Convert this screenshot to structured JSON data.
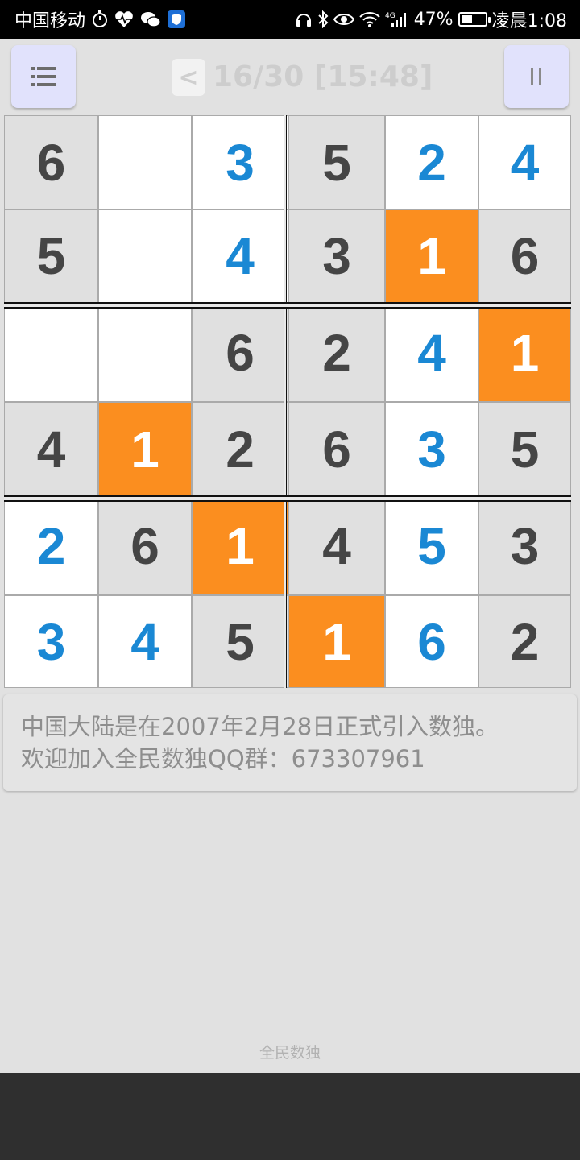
{
  "status_bar": {
    "carrier": "中国移动",
    "battery": "47%",
    "battery_level": 0.47,
    "time": "凌晨1:08",
    "left_icons": [
      "stopwatch-icon",
      "heart-rate-icon",
      "wechat-icon",
      "shield-app-icon"
    ],
    "right_icons": [
      "headset-icon",
      "bluetooth-icon",
      "eye-icon",
      "wifi-icon",
      "signal-4g-icon"
    ]
  },
  "header": {
    "menu_icon": "menu-list-icon",
    "back_label": "<",
    "progress_label": "16/30 [15:48]",
    "pause_label": "II"
  },
  "board": {
    "size": 6,
    "box_rows": 2,
    "box_cols": 3,
    "colors": {
      "given": "#e0e0e0",
      "user": "#1a88d4",
      "highlight": "#fb8e1f",
      "given_text": "#454545"
    },
    "cells": [
      [
        {
          "v": "6",
          "t": "given"
        },
        {
          "v": "",
          "t": "empty"
        },
        {
          "v": "3",
          "t": "user"
        },
        {
          "v": "5",
          "t": "given"
        },
        {
          "v": "2",
          "t": "user"
        },
        {
          "v": "4",
          "t": "user"
        }
      ],
      [
        {
          "v": "5",
          "t": "given"
        },
        {
          "v": "",
          "t": "empty"
        },
        {
          "v": "4",
          "t": "user"
        },
        {
          "v": "3",
          "t": "given"
        },
        {
          "v": "1",
          "t": "hl"
        },
        {
          "v": "6",
          "t": "given"
        }
      ],
      [
        {
          "v": "",
          "t": "empty"
        },
        {
          "v": "",
          "t": "empty"
        },
        {
          "v": "6",
          "t": "given"
        },
        {
          "v": "2",
          "t": "given"
        },
        {
          "v": "4",
          "t": "user"
        },
        {
          "v": "1",
          "t": "hl"
        }
      ],
      [
        {
          "v": "4",
          "t": "given"
        },
        {
          "v": "1",
          "t": "hl"
        },
        {
          "v": "2",
          "t": "given"
        },
        {
          "v": "6",
          "t": "given"
        },
        {
          "v": "3",
          "t": "user"
        },
        {
          "v": "5",
          "t": "given"
        }
      ],
      [
        {
          "v": "2",
          "t": "user"
        },
        {
          "v": "6",
          "t": "given"
        },
        {
          "v": "1",
          "t": "hl"
        },
        {
          "v": "4",
          "t": "given"
        },
        {
          "v": "5",
          "t": "user"
        },
        {
          "v": "3",
          "t": "given"
        }
      ],
      [
        {
          "v": "3",
          "t": "user"
        },
        {
          "v": "4",
          "t": "user"
        },
        {
          "v": "5",
          "t": "given"
        },
        {
          "v": "1",
          "t": "hl"
        },
        {
          "v": "6",
          "t": "user"
        },
        {
          "v": "2",
          "t": "given"
        }
      ]
    ]
  },
  "info": {
    "line1": "中国大陆是在2007年2月28日正式引入数独。",
    "line2": "欢迎加入全民数独QQ群：673307961"
  },
  "footer": {
    "app_name": "全民数独"
  }
}
